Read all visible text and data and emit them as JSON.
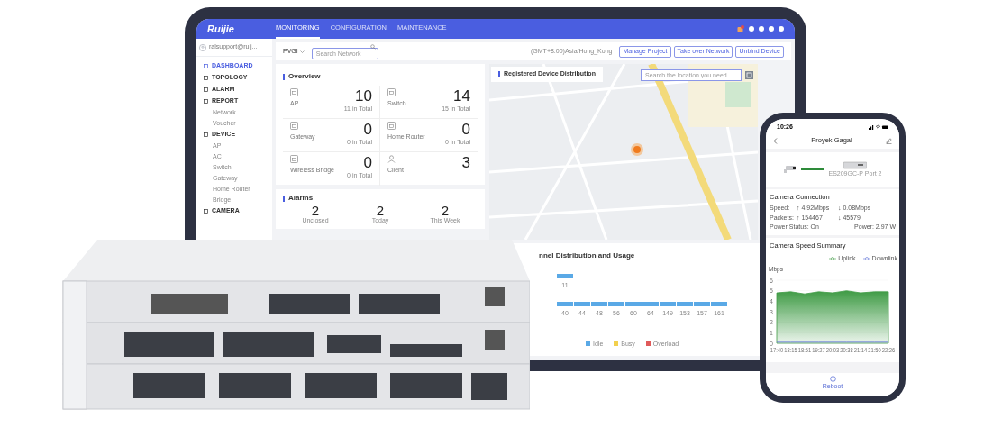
{
  "tablet": {
    "logo": "Ruijie",
    "nav_tabs": [
      {
        "label": "MONITORING",
        "selected": true
      },
      {
        "label": "CONFIGURATION",
        "selected": false
      },
      {
        "label": "MAINTENANCE",
        "selected": false
      }
    ],
    "user": "ralsupport@ruij...",
    "sidebar": {
      "items": [
        {
          "label": "DASHBOARD",
          "selected": true
        },
        {
          "label": "TOPOLOGY",
          "selected": false
        },
        {
          "label": "ALARM",
          "selected": false
        },
        {
          "label": "REPORT",
          "selected": false,
          "children": [
            {
              "label": "Network",
              "selected": false
            },
            {
              "label": "Voucher",
              "selected": false
            }
          ]
        },
        {
          "label": "DEVICE",
          "selected": false,
          "children": [
            {
              "label": "AP",
              "selected": false
            },
            {
              "label": "AC",
              "selected": false
            },
            {
              "label": "Switch",
              "selected": false
            },
            {
              "label": "Gateway",
              "selected": false
            },
            {
              "label": "Home Router",
              "selected": false
            },
            {
              "label": "Bridge",
              "selected": false
            }
          ]
        },
        {
          "label": "CAMERA",
          "selected": false
        }
      ]
    },
    "toolbar": {
      "project": "PVGI",
      "search_placeholder": "Search Network",
      "timezone": "(GMT+8:00)Asia/Hong_Kong",
      "buttons": [
        "Manage Project",
        "Take over Network",
        "Unbind Device"
      ]
    },
    "overview": {
      "title": "Overview",
      "tiles": [
        {
          "kind": "device",
          "label": "AP",
          "count": "10",
          "total": "11 in Total"
        },
        {
          "kind": "device",
          "label": "Switch",
          "count": "14",
          "total": "15 in Total"
        },
        {
          "kind": "device",
          "label": "Gateway",
          "count": "0",
          "total": "0 in Total"
        },
        {
          "kind": "device",
          "label": "Home Router",
          "count": "0",
          "total": "0 in Total"
        },
        {
          "kind": "device",
          "label": "Wireless Bridge",
          "count": "0",
          "total": "0 in Total"
        },
        {
          "kind": "client",
          "label": "Client",
          "count": "3"
        }
      ]
    },
    "alarms": {
      "title": "Alarms",
      "stats": [
        {
          "count": "2",
          "label": "Unclosed"
        },
        {
          "count": "2",
          "label": "Today"
        },
        {
          "count": "2",
          "label": "This Week"
        }
      ]
    },
    "map": {
      "title": "Registered Device Distribution",
      "search_placeholder": "Search the location you need."
    },
    "channels": {
      "title": "nnel Distribution and Usage",
      "bands": [
        {
          "labels": [
            "11"
          ]
        },
        {
          "labels": [
            "40",
            "44",
            "48",
            "56",
            "60",
            "64",
            "149",
            "153",
            "157",
            "161"
          ]
        }
      ],
      "legend": [
        {
          "label": "Idle",
          "color": "#5aa9e6"
        },
        {
          "label": "Busy",
          "color": "#f2d04e"
        },
        {
          "label": "Overload",
          "color": "#e05a5a"
        }
      ]
    }
  },
  "phone": {
    "time": "10:26",
    "title": "Proyek Gagal",
    "device_label": "ES209GC-P Port 2",
    "connection": {
      "title": "Camera Connection",
      "rows": [
        {
          "label": "Speed:",
          "up": "↑ 4.92Mbps",
          "down": "↓ 0.08Mbps"
        },
        {
          "label": "Packets:",
          "up": "↑ 154467",
          "down": "↓ 45579"
        }
      ],
      "power_status": "Power Status: On",
      "power": "Power: 2.97 W"
    },
    "summary": {
      "title": "Camera Speed Summary",
      "chart_data": {
        "type": "area",
        "ylabel": "Mbps",
        "categories": [
          "17:40",
          "18:15",
          "18:51",
          "19:27",
          "20:03",
          "20:38",
          "21:14",
          "21:50",
          "22:26"
        ],
        "ylim": [
          0,
          6
        ],
        "yticks": [
          0,
          1,
          2,
          3,
          4,
          5,
          6
        ],
        "series": [
          {
            "name": "Uplink",
            "type": "area",
            "color": "#3f9b45",
            "values": [
              4.8,
              4.9,
              4.7,
              4.9,
              4.8,
              5.0,
              4.8,
              4.9,
              4.9
            ]
          },
          {
            "name": "Downlink",
            "type": "line",
            "color": "#5b6fd6",
            "values": [
              0.1,
              0.1,
              0.1,
              0.1,
              0.1,
              0.1,
              0.1,
              0.1,
              0.1
            ]
          }
        ]
      }
    },
    "tab": "Reboot"
  }
}
